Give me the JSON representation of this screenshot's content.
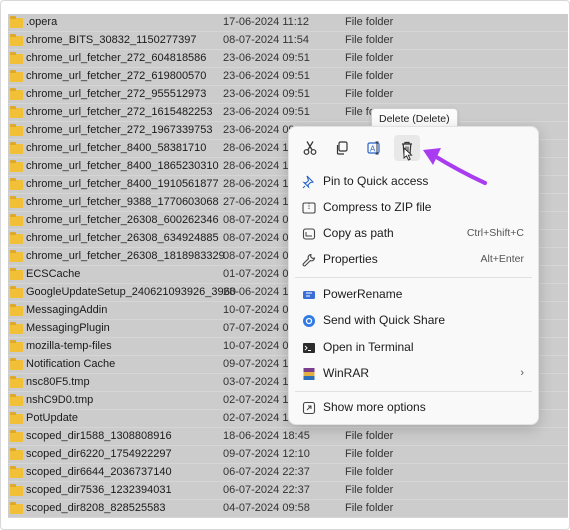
{
  "files": [
    {
      "name": ".opera",
      "date": "17-06-2024 11:12",
      "type": "File folder"
    },
    {
      "name": "chrome_BITS_30832_1150277397",
      "date": "08-07-2024 11:54",
      "type": "File folder"
    },
    {
      "name": "chrome_url_fetcher_272_604818586",
      "date": "23-06-2024 09:51",
      "type": "File folder"
    },
    {
      "name": "chrome_url_fetcher_272_619800570",
      "date": "23-06-2024 09:51",
      "type": "File folder"
    },
    {
      "name": "chrome_url_fetcher_272_955512973",
      "date": "23-06-2024 09:51",
      "type": "File folder"
    },
    {
      "name": "chrome_url_fetcher_272_1615482253",
      "date": "23-06-2024 09:51",
      "type": "File fo"
    },
    {
      "name": "chrome_url_fetcher_272_1967339753",
      "date": "23-06-2024 09",
      "type": ""
    },
    {
      "name": "chrome_url_fetcher_8400_58381710",
      "date": "28-06-2024 13",
      "type": ""
    },
    {
      "name": "chrome_url_fetcher_8400_1865230310",
      "date": "28-06-2024 13",
      "type": ""
    },
    {
      "name": "chrome_url_fetcher_8400_1910561877",
      "date": "28-06-2024 13",
      "type": ""
    },
    {
      "name": "chrome_url_fetcher_9388_1770603068",
      "date": "27-06-2024 18",
      "type": ""
    },
    {
      "name": "chrome_url_fetcher_26308_600262346",
      "date": "08-07-2024 08",
      "type": ""
    },
    {
      "name": "chrome_url_fetcher_26308_634924885",
      "date": "08-07-2024 08",
      "type": ""
    },
    {
      "name": "chrome_url_fetcher_26308_1818983329",
      "date": "08-07-2024 08",
      "type": ""
    },
    {
      "name": "ECSCache",
      "date": "01-07-2024 09",
      "type": ""
    },
    {
      "name": "GoogleUpdateSetup_240621093926_3960",
      "date": "28-06-2024 15",
      "type": ""
    },
    {
      "name": "MessagingAddin",
      "date": "10-07-2024 09",
      "type": ""
    },
    {
      "name": "MessagingPlugin",
      "date": "07-07-2024 09",
      "type": ""
    },
    {
      "name": "mozilla-temp-files",
      "date": "10-07-2024 08",
      "type": ""
    },
    {
      "name": "Notification Cache",
      "date": "09-07-2024 12",
      "type": ""
    },
    {
      "name": "nsc80F5.tmp",
      "date": "03-07-2024 10",
      "type": ""
    },
    {
      "name": "nshC9D0.tmp",
      "date": "02-07-2024 10",
      "type": ""
    },
    {
      "name": "PotUpdate",
      "date": "02-07-2024 10",
      "type": ""
    },
    {
      "name": "scoped_dir1588_1308808916",
      "date": "18-06-2024 18:45",
      "type": "File folder"
    },
    {
      "name": "scoped_dir6220_1754922297",
      "date": "09-07-2024 12:10",
      "type": "File folder"
    },
    {
      "name": "scoped_dir6644_2036737140",
      "date": "06-07-2024 22:37",
      "type": "File folder"
    },
    {
      "name": "scoped_dir7536_1232394031",
      "date": "06-07-2024 22:37",
      "type": "File folder"
    },
    {
      "name": "scoped_dir8208_828525583",
      "date": "04-07-2024 09:58",
      "type": "File folder"
    }
  ],
  "tooltip": "Delete (Delete)",
  "quick_actions": [
    "cut-icon",
    "copy-icon",
    "rename-icon",
    "delete-icon"
  ],
  "menu": {
    "pin": "Pin to Quick access",
    "compress": "Compress to ZIP file",
    "copy_path": "Copy as path",
    "copy_path_shortcut": "Ctrl+Shift+C",
    "properties": "Properties",
    "properties_shortcut": "Alt+Enter",
    "powerrename": "PowerRename",
    "quick_share": "Send with Quick Share",
    "terminal": "Open in Terminal",
    "winrar": "WinRAR",
    "more_options": "Show more options"
  },
  "colors": {
    "selection": "#cccccc",
    "folder": "#f2c037",
    "accent_arrow": "#a93bf0"
  }
}
